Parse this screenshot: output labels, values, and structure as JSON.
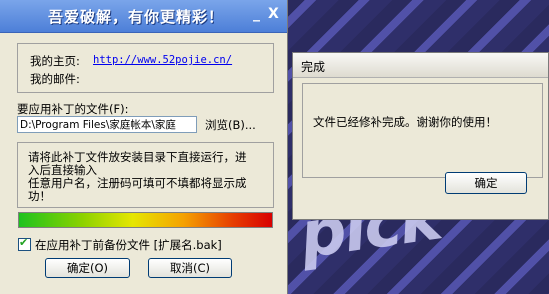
{
  "patch_window": {
    "title": "吾爱破解，有你更精彩！",
    "min_glyph": "_",
    "close_glyph": "X",
    "home_label": "我的主页:",
    "home_url": "http://www.52pojie.cn/",
    "email_label": "我的邮件:",
    "file_label": "要应用补丁的文件(F):",
    "file_value": "D:\\Program Files\\家庭帐本\\家庭",
    "browse_label": "浏览(B)...",
    "note_line1": "请将此补丁文件放安装目录下直接运行，进",
    "note_line2": "入后直接输入",
    "note_line3": "任意用户名，注册码可填可不填都将显示成",
    "note_line4": "功！",
    "backup_label": "在应用补丁前备份文件 [扩展名.bak]",
    "ok_label": "确定(O)",
    "cancel_label": "取消(C)"
  },
  "done_dialog": {
    "title": "完成",
    "message": "文件已经修补完成。谢谢你的使用！",
    "ok_label": "确定"
  },
  "background": {
    "word": "pick"
  }
}
